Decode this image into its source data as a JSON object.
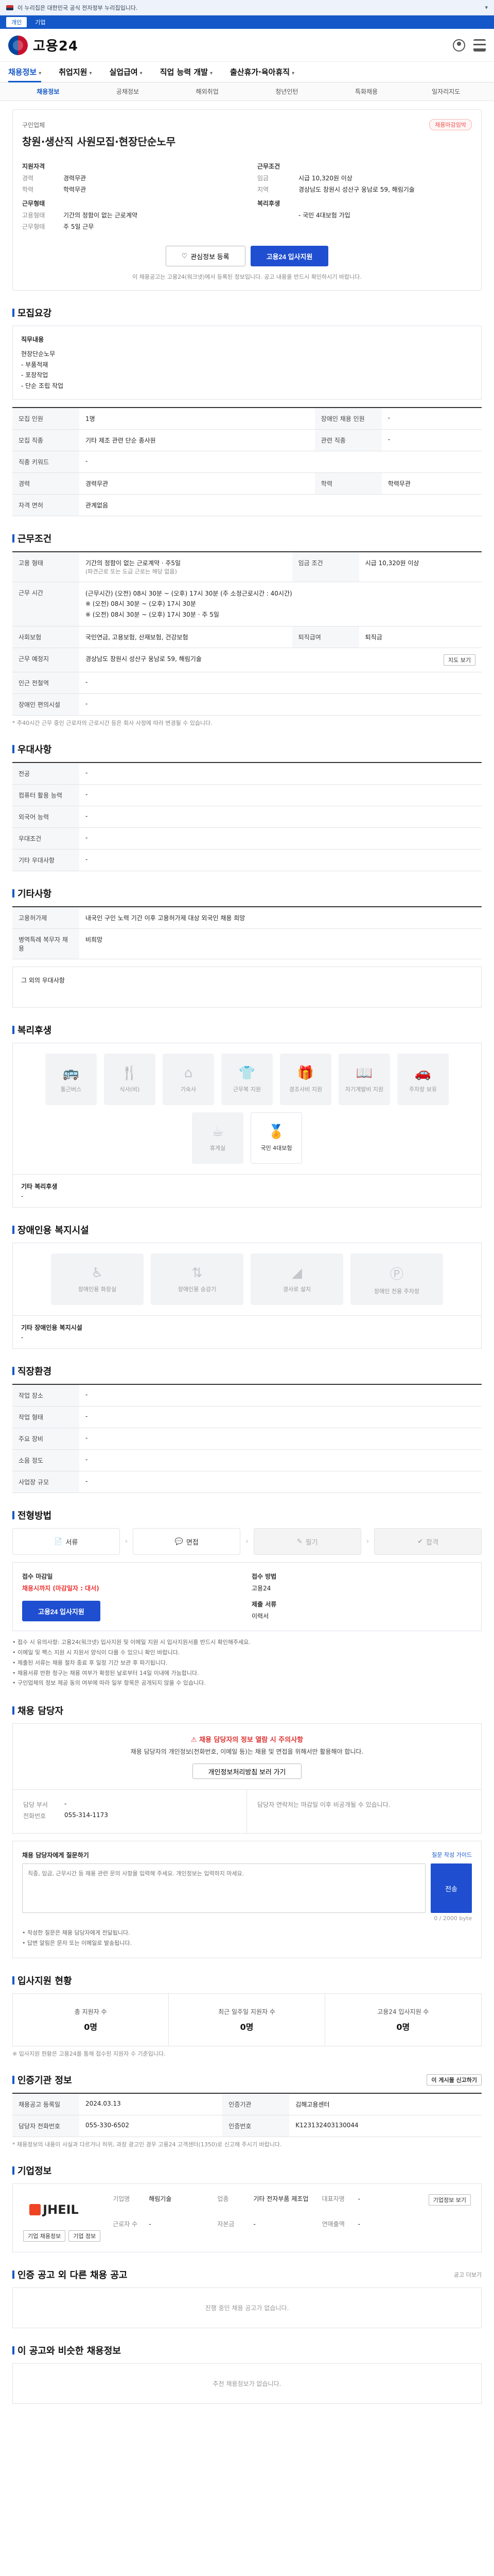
{
  "top_notice": "이 누리집은 대한민국 공식 전자정부 누리집입니다.",
  "util": [
    "개인",
    "기업"
  ],
  "logo": "고용24",
  "gnb": [
    {
      "label": "채용정보"
    },
    {
      "label": "취업지원"
    },
    {
      "label": "실업급여"
    },
    {
      "label": "직업 능력 개발"
    },
    {
      "label": "출산휴가·육아휴직"
    }
  ],
  "subnav": [
    "채용정보",
    "공채정보",
    "해외취업",
    "청년인턴",
    "특화채용",
    "일자리지도"
  ],
  "job": {
    "company": "구인업체",
    "badge": "채용마감임박",
    "title": "창원·생산직 사원모집·현장단순노무",
    "left_heading": "지원자격",
    "left": [
      {
        "k": "경력",
        "v": "경력무관"
      },
      {
        "k": "학력",
        "v": "학력무관"
      }
    ],
    "left2_heading": "근무형태",
    "left2": [
      {
        "k": "고용형태",
        "v": "기간의 정함이 없는 근로계약"
      },
      {
        "k": "근무형태",
        "v": "주 5일 근무"
      }
    ],
    "right_heading": "근무조건",
    "right": [
      {
        "k": "임금",
        "v": "시급 10,320원 이상"
      },
      {
        "k": "지역",
        "v": "경상남도 창원시 성산구 웅남로 59, 해림기술"
      }
    ],
    "right2_heading": "복리후생",
    "right2": [
      {
        "k": "",
        "v": "- 국민 4대보험 가입"
      }
    ],
    "btn_scrap": "관심정보 등록",
    "btn_apply": "고용24 입사지원",
    "note": "이 채용공고는 고용24(워크넷)에서 등록된 정보입니다. 공고 내용을 반드시 확인하시기 바랍니다."
  },
  "duty": {
    "title": "모집요강",
    "label": "직무내용",
    "text": "현장단순노무\n- 부품적재\n- 포장작업\n- 단순 조립 작업"
  },
  "recruit": {
    "rows": [
      {
        "k1": "모집 인원",
        "v1": "1명",
        "k2": "장애인 채용 인원",
        "v2": "-"
      },
      {
        "k1": "모집 직종",
        "v1": "기타 제조 관련 단순 종사원",
        "k2": "관련 직종",
        "v2": "-"
      },
      {
        "k1": "직종 키워드",
        "v1": "-",
        "k2": "",
        "v2": ""
      },
      {
        "k1": "경력",
        "v1": "경력무관",
        "k2": "학력",
        "v2": "학력무관"
      },
      {
        "k1": "자격 면허",
        "v1": "관계없음",
        "k2": "",
        "v2": ""
      }
    ]
  },
  "work": {
    "title": "근무조건",
    "employ_type_k": "고용 형태",
    "employ_type_v": "기간의 정함이 없는 근로계약 · 주5일",
    "employ_type_sub": "(파견근로 또는 도급 근로는 해당 없음)",
    "wage_k": "임금 조건",
    "wage_v": "시급 10,320원 이상",
    "time_k": "근무 시간",
    "time_v": "(근무시간) (오전) 08시 30분 ~ (오후) 17시 30분 (주 소정근로시간 : 40시간)\n※ (오전) 08시 30분 ~ (오후) 17시 30분\n※ (오전) 08시 30분 ~ (오후) 17시 30분 · 주 5일",
    "insure_k": "사회보험",
    "insure_v": "국민연금, 고용보험, 산재보험, 건강보험",
    "retire_k": "퇴직급여",
    "retire_v": "퇴직금",
    "place_k": "근무 예정지",
    "place_v": "경상남도 창원시 성산구 웅남로 59, 해림기술",
    "map_btn": "지도 보기",
    "near_k": "인근 전철역",
    "near_v": "-",
    "handicap_k": "장애인 편의시설",
    "handicap_v": "-",
    "footnote": "* 주40시간 근무 중인 근로자의 근로시간 등은 회사 사정에 따라 변경될 수 있습니다."
  },
  "treat": {
    "title": "우대사항",
    "rows": [
      {
        "k": "전공",
        "v": "-"
      },
      {
        "k": "컴퓨터 활용 능력",
        "v": "-"
      },
      {
        "k": "외국어 능력",
        "v": "-"
      },
      {
        "k": "우대조건",
        "v": "-"
      },
      {
        "k": "기타 우대사항",
        "v": "-"
      }
    ]
  },
  "etc": {
    "title": "기타사항",
    "rows": [
      {
        "k": "고용허가제",
        "v": "내국인 구인 노력 기간 이후 고용허가제 대상 외국인 채용 희망"
      },
      {
        "k": "병역특례 복무자 채용",
        "v": "비희망"
      }
    ],
    "extra": "그 외의 우대사항"
  },
  "welfare": {
    "title": "복리후생",
    "tiles": [
      {
        "icon": "bus-icon",
        "label": "통근버스",
        "on": false
      },
      {
        "icon": "meal-icon",
        "label": "식사(비)",
        "on": false
      },
      {
        "icon": "house-icon",
        "label": "기숙사",
        "on": false
      },
      {
        "icon": "shirt-icon",
        "label": "근무복 지원",
        "on": false
      },
      {
        "icon": "gift-icon",
        "label": "경조사비 지원",
        "on": false
      },
      {
        "icon": "book-icon",
        "label": "자기계발비 지원",
        "on": false
      },
      {
        "icon": "car-icon",
        "label": "주차장 보유",
        "on": false
      },
      {
        "icon": "coffee-icon",
        "label": "휴게실",
        "on": false
      },
      {
        "icon": "medal-icon",
        "label": "국민 4대보험",
        "on": true
      }
    ],
    "foot_label": "기타 복리후생",
    "foot_value": "-"
  },
  "handicap": {
    "title": "장애인용 복지시설",
    "tiles": [
      {
        "icon": "wheelchair-icon",
        "label": "장애인용 화장실",
        "on": false
      },
      {
        "icon": "elevator-icon",
        "label": "장애인용 승강기",
        "on": false
      },
      {
        "icon": "ramp-icon",
        "label": "경사로 설치",
        "on": false
      },
      {
        "icon": "parking-icon",
        "label": "장애인 전용 주차장",
        "on": false
      }
    ],
    "foot_label": "기타 장애인용 복지시설",
    "foot_value": "-"
  },
  "company_info": {
    "title": "직장환경",
    "rows": [
      {
        "k1": "작업 장소",
        "v1": "-",
        "k2": "",
        "v2": ""
      },
      {
        "k1": "작업 형태",
        "v1": "-",
        "k2": "",
        "v2": ""
      },
      {
        "k1": "주요 장비",
        "v1": "-",
        "k2": "",
        "v2": ""
      },
      {
        "k1": "소음 정도",
        "v1": "-",
        "k2": "",
        "v2": ""
      },
      {
        "k1": "사업장 규모",
        "v1": "-",
        "k2": "",
        "v2": ""
      }
    ]
  },
  "process": {
    "title": "전형방법",
    "steps": [
      {
        "icon": "doc-icon",
        "label": "서류",
        "dim": false
      },
      {
        "icon": "chat-icon",
        "label": "면접",
        "dim": false
      },
      {
        "icon": "test-icon",
        "label": "필기",
        "dim": true
      },
      {
        "icon": "check-icon",
        "label": "합격",
        "dim": true
      }
    ],
    "deadline_k": "접수 마감일",
    "deadline_v": "채용시까지 (마감일자 : 대서)",
    "method_k": "접수 방법",
    "method_v": "고용24",
    "apply_btn": "고용24 입사지원",
    "doc_k": "제출 서류",
    "doc_v": "이력서",
    "notes": [
      "접수 시 유의사항: 고용24(워크넷) 입사지원 및 이메일 지원 시 입사지원서를 반드시 확인해주세요.",
      "이메일 및 팩스 지원 시 지원서 양식이 다를 수 있으니 확인 바랍니다.",
      "제출된 서류는 채용 절차 종료 후 일정 기간 보관 후 파기됩니다.",
      "채용서류 반환 청구는 채용 여부가 확정된 날로부터 14일 이내에 가능합니다.",
      "구인업체의 정보 제공 동의 여부에 따라 일부 항목은 공개되지 않을 수 있습니다."
    ]
  },
  "contact": {
    "title": "채용 담당자",
    "warn": "채용 담당자의 정보 열람 시 주의사항",
    "warn_body": "채용 담당자의 개인정보(전화번호, 이메일 등)는 채용 및 면접을 위해서만 활용해야 합니다.",
    "btn": "개인정보처리방침 보러 가기",
    "dept_k": "담당 부서",
    "dept_v": "-",
    "phone_k": "전화번호",
    "phone_v": "055-314-1173",
    "right_text": "담당자 연락처는 마감일 이후 비공개될 수 있습니다."
  },
  "qna": {
    "head": "채용 담당자에게 질문하기",
    "head_r": "질문 작성 가이드",
    "placeholder": "직종, 임금, 근무시간 등 채용 관련 문의 사항을 입력해 주세요. 개인정보는 입력하지 마세요.",
    "send": "전송",
    "count": "0 / 2000 byte",
    "notes": [
      "작성한 질문은 채용 담당자에게 전달됩니다.",
      "답변 알림은 문자 또는 이메일로 발송됩니다."
    ]
  },
  "stats": {
    "title": "입사지원 현황",
    "items": [
      {
        "lbl": "총 지원자 수",
        "val": "0명"
      },
      {
        "lbl": "최근 일주일 지원자 수",
        "val": "0명"
      },
      {
        "lbl": "고용24 입사지원 수",
        "val": "0명"
      }
    ],
    "note": "※ 입사지원 현황은 고용24를 통해 접수된 지원자 수 기준입니다."
  },
  "posting": {
    "title": "인증기관 정보",
    "btn": "이 게시물 신고하기",
    "rows": [
      {
        "k1": "채용공고 등록일",
        "v1": "2024.03.13",
        "k2": "인증기관",
        "v2": "김해고용센터"
      },
      {
        "k1": "담당자 전화번호",
        "v1": "055-330-6502",
        "k2": "인증번호",
        "v2": "K123132403130044"
      }
    ],
    "footnote": "* 채용정보의 내용이 사실과 다르거나 허위, 과장 광고인 경우 고용24 고객센터(1350)로 신고해 주시기 바랍니다."
  },
  "company": {
    "title": "기업정보",
    "logo_text": "JHEIL",
    "btn": "기업정보 보기",
    "fields": [
      {
        "k": "기업명",
        "v": "해림기술"
      },
      {
        "k": "업종",
        "v": "기타 전자부품 제조업"
      },
      {
        "k": "대표자명",
        "v": "-"
      },
      {
        "k": "근로자 수",
        "v": "-"
      },
      {
        "k": "자본금",
        "v": "-"
      },
      {
        "k": "연매출액",
        "v": "-"
      }
    ],
    "sub_btn1": "기업 채용정보",
    "sub_btn2": "기업 정보"
  },
  "other_jobs": {
    "title": "인증 공고 외 다른 채용 공고",
    "right": "공고 더보기",
    "empty": "진행 중인 채용 공고가 없습니다."
  },
  "recommend": {
    "title": "이 공고와 비슷한 채용정보",
    "empty": "추천 채용정보가 없습니다."
  }
}
